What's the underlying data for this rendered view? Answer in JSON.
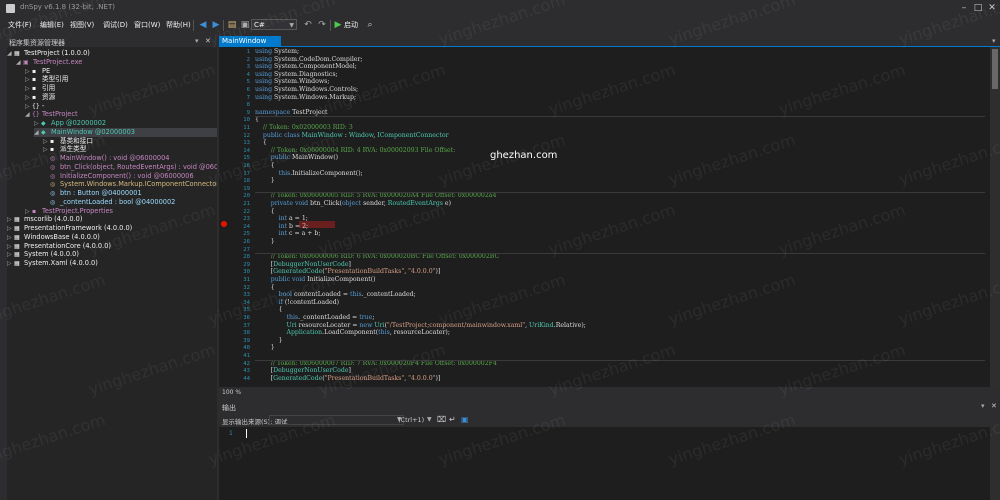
{
  "window": {
    "title": "dnSpy v6.1.8 (32-bit, .NET)"
  },
  "menu": [
    "文件(F)",
    "编辑(E)",
    "视图(V)",
    "调试(D)",
    "窗口(W)",
    "帮助(H)"
  ],
  "toolbar": {
    "language": "C#",
    "start_label": "启动"
  },
  "left_panel": {
    "title": "程序集资源管理器",
    "rows": [
      {
        "exp": "◢",
        "icon": "▦",
        "text": "TestProject (1.0.0.0)",
        "color": "#f1f1f1",
        "indent": 0
      },
      {
        "exp": "◢",
        "icon": "▣",
        "text": "TestProject.exe",
        "color": "#c586c0",
        "indent": 1
      },
      {
        "exp": "▷",
        "icon": "▪",
        "text": "PE",
        "color": "#f1f1f1",
        "indent": 2
      },
      {
        "exp": "▷",
        "icon": "▪",
        "text": "类型引用",
        "color": "#f1f1f1",
        "indent": 2
      },
      {
        "exp": "▷",
        "icon": "▪",
        "text": "引用",
        "color": "#f1f1f1",
        "indent": 2
      },
      {
        "exp": "▷",
        "icon": "▪",
        "text": "资源",
        "color": "#f1f1f1",
        "indent": 2
      },
      {
        "exp": "▷",
        "icon": "{}",
        "text": "-",
        "color": "#f1f1f1",
        "indent": 2
      },
      {
        "exp": "◢",
        "icon": "{}",
        "text": "TestProject",
        "color": "#c586c0",
        "indent": 2
      },
      {
        "exp": "▷",
        "icon": "◆",
        "text": "App @02000002",
        "color": "#4ec9b0",
        "indent": 3
      },
      {
        "exp": "◢",
        "icon": "◆",
        "text": "MainWindow @02000003",
        "color": "#4ec9b0",
        "indent": 3,
        "selected": true
      },
      {
        "exp": "▷",
        "icon": "▪",
        "text": "基类和接口",
        "color": "#f1f1f1",
        "indent": 4
      },
      {
        "exp": "▷",
        "icon": "▪",
        "text": "派生类型",
        "color": "#f1f1f1",
        "indent": 4
      },
      {
        "exp": "",
        "icon": "◎",
        "text": "MainWindow() : void @06000004",
        "color": "#c586c0",
        "indent": 4
      },
      {
        "exp": "",
        "icon": "◎",
        "text": "btn_Click(object, RoutedEventArgs) : void @0600",
        "color": "#c586c0",
        "indent": 4
      },
      {
        "exp": "",
        "icon": "◎",
        "text": "InitializeComponent() : void @06000006",
        "color": "#c586c0",
        "indent": 4
      },
      {
        "exp": "",
        "icon": "◎",
        "text": "System.Windows.Markup.IComponentConnector",
        "color": "#d7ba7d",
        "indent": 4
      },
      {
        "exp": "",
        "icon": "◎",
        "text": "btn : Button @04000001",
        "color": "#9cdcfe",
        "indent": 4
      },
      {
        "exp": "",
        "icon": "◎",
        "text": "_contentLoaded : bool @04000002",
        "color": "#9cdcfe",
        "indent": 4
      },
      {
        "exp": "▷",
        "icon": "▪",
        "text": "TestProject.Properties",
        "color": "#c586c0",
        "indent": 2
      },
      {
        "exp": "▷",
        "icon": "▦",
        "text": "mscorlib (4.0.0.0)",
        "color": "#f1f1f1",
        "indent": 0
      },
      {
        "exp": "▷",
        "icon": "▦",
        "text": "PresentationFramework (4.0.0.0)",
        "color": "#f1f1f1",
        "indent": 0
      },
      {
        "exp": "▷",
        "icon": "▦",
        "text": "WindowsBase (4.0.0.0)",
        "color": "#f1f1f1",
        "indent": 0
      },
      {
        "exp": "▷",
        "icon": "▦",
        "text": "PresentationCore (4.0.0.0)",
        "color": "#f1f1f1",
        "indent": 0
      },
      {
        "exp": "▷",
        "icon": "▦",
        "text": "System (4.0.0.0)",
        "color": "#f1f1f1",
        "indent": 0
      },
      {
        "exp": "▷",
        "icon": "▦",
        "text": "System.Xaml (4.0.0.0)",
        "color": "#f1f1f1",
        "indent": 0
      }
    ]
  },
  "editor": {
    "tab": "MainWindow",
    "zoom": "100 %",
    "lines": [
      {
        "n": "1",
        "html": "<span class='kw'>using</span> System;"
      },
      {
        "n": "2",
        "html": "<span class='kw'>using</span> System.CodeDom.Compiler;"
      },
      {
        "n": "3",
        "html": "<span class='kw'>using</span> System.ComponentModel;"
      },
      {
        "n": "4",
        "html": "<span class='kw'>using</span> System.Diagnostics;"
      },
      {
        "n": "5",
        "html": "<span class='kw'>using</span> System.Windows;"
      },
      {
        "n": "6",
        "html": "<span class='kw'>using</span> System.Windows.Controls;"
      },
      {
        "n": "7",
        "html": "<span class='kw'>using</span> System.Windows.Markup;"
      },
      {
        "n": "8",
        "html": ""
      },
      {
        "n": "9",
        "html": "<span class='kw'>namespace</span> TestProject"
      },
      {
        "n": "10",
        "html": "{"
      },
      {
        "n": "11",
        "html": "    <span class='cm'>// Token: 0x02000003 RID: 3</span>"
      },
      {
        "n": "12",
        "html": "    <span class='kw'>public class</span> <span class='ty'>MainWindow</span> : <span class='ty'>Window</span>, <span class='ty'>IComponentConnector</span>"
      },
      {
        "n": "13",
        "html": "    {"
      },
      {
        "n": "14",
        "html": "        <span class='cm'>// Token: 0x06000004 RID: 4 RVA: 0x00002093 File Offset:</span>"
      },
      {
        "n": "15",
        "html": "        <span class='kw'>public</span> MainWindow()"
      },
      {
        "n": "16",
        "html": "        {"
      },
      {
        "n": "17",
        "html": "            <span class='kw'>this</span>.InitializeComponent();"
      },
      {
        "n": "18",
        "html": "        }"
      },
      {
        "n": "19",
        "html": ""
      },
      {
        "n": "20",
        "html": "        <span class='cm'>// Token: 0x06000005 RID: 5 RVA: 0x000020A4 File Offset: 0x000002a4</span>"
      },
      {
        "n": "21",
        "html": "        <span class='kw'>private void</span> btn_Click(<span class='kw'>object</span> sender, <span class='ty'>RoutedEventArgs</span> e)"
      },
      {
        "n": "22",
        "html": "        {"
      },
      {
        "n": "23",
        "html": "            <span class='kw'>int</span> a = 1;"
      },
      {
        "n": "24",
        "html": "            <span class='kw'>int</span> b = 2;"
      },
      {
        "n": "25",
        "html": "            <span class='kw'>int</span> c = a + b;"
      },
      {
        "n": "26",
        "html": "        }"
      },
      {
        "n": "27",
        "html": ""
      },
      {
        "n": "28",
        "html": "        <span class='cm'>// Token: 0x06000006 RID: 6 RVA: 0x000020BC File Offset: 0x000002BC</span>"
      },
      {
        "n": "29",
        "html": "        [<span class='ty'>DebuggerNonUserCode</span>]"
      },
      {
        "n": "30",
        "html": "        [<span class='ty'>GeneratedCode</span>(<span class='st'>\"PresentationBuildTasks\"</span>, <span class='st'>\"4.0.0.0\"</span>)]"
      },
      {
        "n": "31",
        "html": "        <span class='kw'>public void</span> InitializeComponent()"
      },
      {
        "n": "32",
        "html": "        {"
      },
      {
        "n": "33",
        "html": "            <span class='kw'>bool</span> contentLoaded = <span class='kw'>this</span>._contentLoaded;"
      },
      {
        "n": "34",
        "html": "            <span class='kw'>if</span> (!contentLoaded)"
      },
      {
        "n": "35",
        "html": "            {"
      },
      {
        "n": "36",
        "html": "                <span class='kw'>this</span>._contentLoaded = <span class='kw'>true</span>;"
      },
      {
        "n": "37",
        "html": "                <span class='ty'>Uri</span> resourceLocater = <span class='kw'>new</span> <span class='ty'>Uri</span>(<span class='st'>\"/TestProject;component/mainwindow.xaml\"</span>, <span class='ty'>UriKind</span>.Relative);"
      },
      {
        "n": "38",
        "html": "                <span class='ty'>Application</span>.LoadComponent(<span class='kw'>this</span>, resourceLocater);"
      },
      {
        "n": "39",
        "html": "            }"
      },
      {
        "n": "40",
        "html": "        }"
      },
      {
        "n": "41",
        "html": ""
      },
      {
        "n": "42",
        "html": "        <span class='cm'>// Token: 0x06000007 RID: 7 RVA: 0x000020F4 File Offset: 0x000002F4</span>"
      },
      {
        "n": "43",
        "html": "        [<span class='ty'>DebuggerNonUserCode</span>]"
      },
      {
        "n": "44",
        "html": "        [<span class='ty'>GeneratedCode</span>(<span class='st'>\"PresentationBuildTasks\"</span>, <span class='st'>\"4.0.0.0\"</span>)]"
      }
    ]
  },
  "output": {
    "title": "输出",
    "source_label": "显示输出来源(S): 调试",
    "shortcut": "(Ctrl+1)",
    "line_number": "1"
  },
  "watermark": "yinghezhan.com",
  "overlay_text": "ghezhan.com"
}
